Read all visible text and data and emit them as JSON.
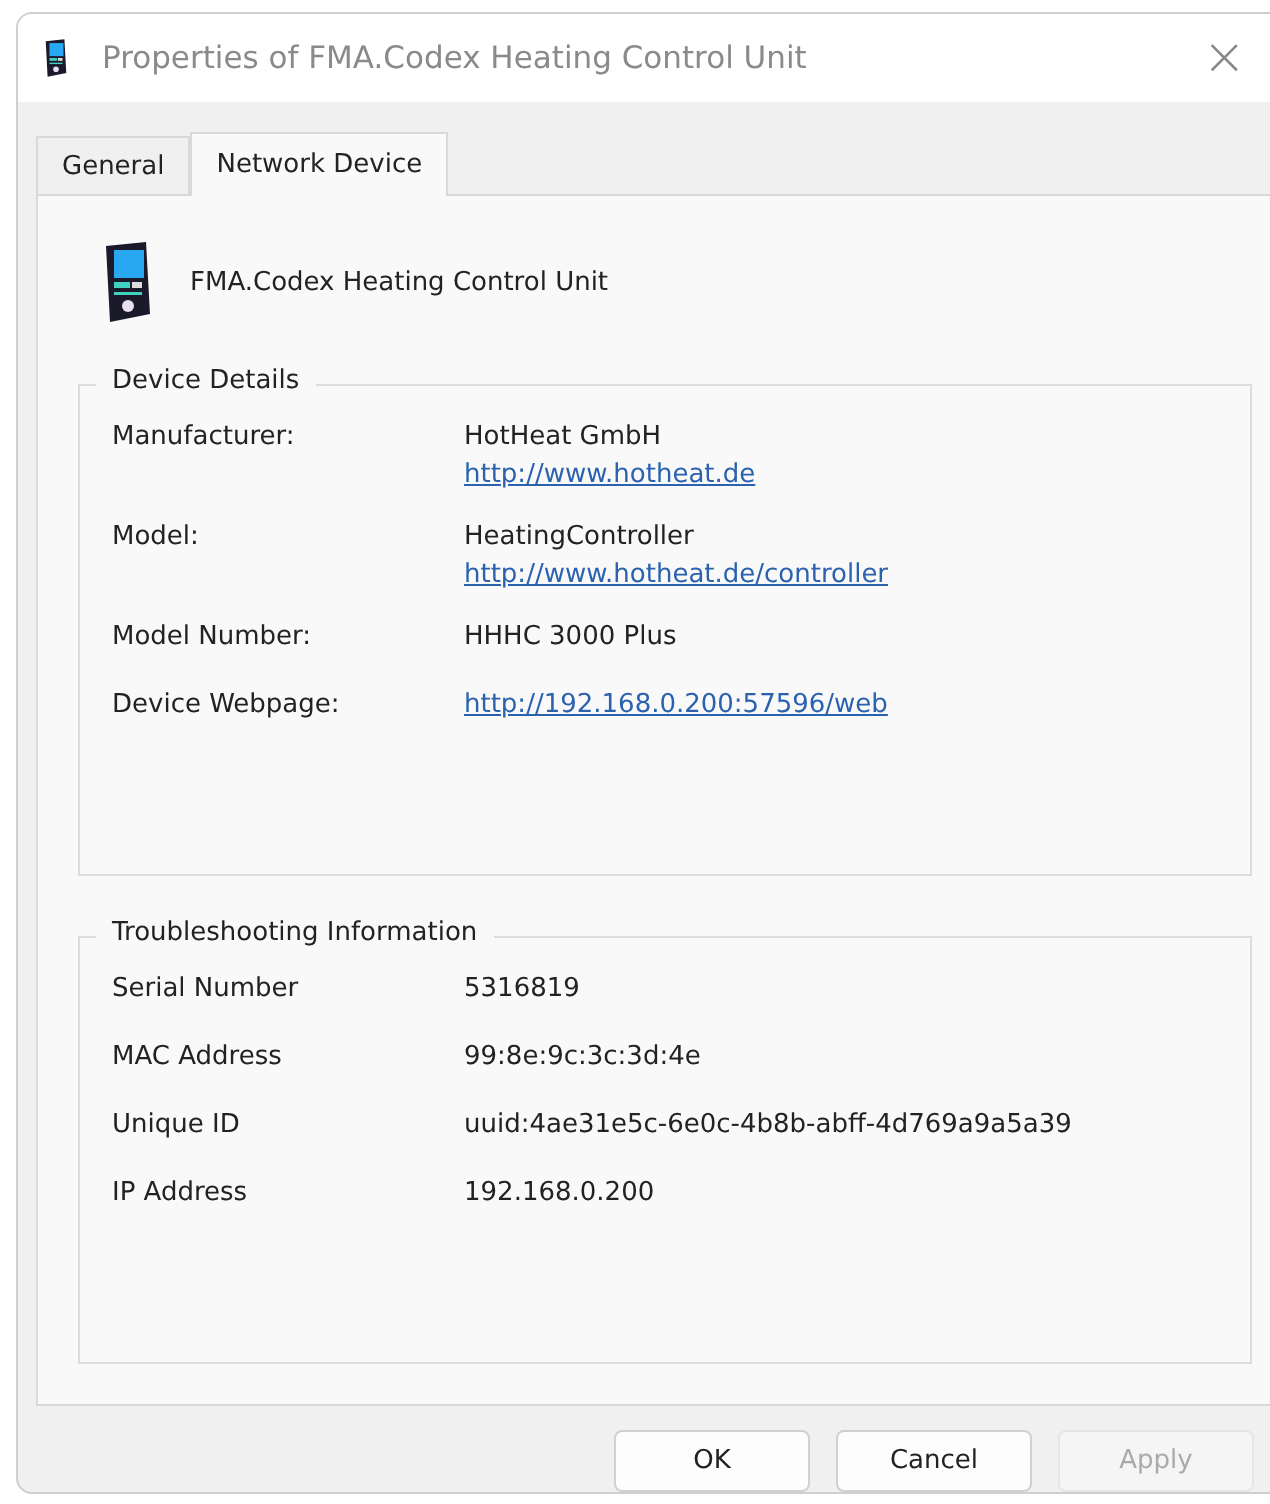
{
  "window": {
    "title": "Properties of FMA.Codex Heating Control Unit",
    "close": "×"
  },
  "tabs": [
    {
      "label": "General",
      "selected": false
    },
    {
      "label": "Network Device",
      "selected": true
    }
  ],
  "device_name": "FMA.Codex Heating Control Unit",
  "groups": [
    {
      "title": "Device Details",
      "rows": [
        {
          "label": "Manufacturer:",
          "value": "HotHeat GmbH",
          "link": "http://www.hotheat.de"
        },
        {
          "label": "Model:",
          "value": "HeatingController",
          "link": "http://www.hotheat.de/controller"
        },
        {
          "label": "Model Number:",
          "value": "HHHC 3000 Plus"
        },
        {
          "label": "Device Webpage:",
          "link": "http://192.168.0.200:57596/web"
        }
      ]
    },
    {
      "title": "Troubleshooting Information",
      "rows": [
        {
          "label": "Serial Number",
          "value": "5316819"
        },
        {
          "label": "MAC Address",
          "value": "99:8e:9c:3c:3d:4e"
        },
        {
          "label": "Unique ID",
          "value": "uuid:4ae31e5c-6e0c-4b8b-abff-4d769a9a5a39"
        },
        {
          "label": "IP Address",
          "value": "192.168.0.200"
        }
      ]
    }
  ],
  "buttons": [
    {
      "label": "OK",
      "disabled": false
    },
    {
      "label": "Cancel",
      "disabled": false
    },
    {
      "label": "Apply",
      "disabled": true
    }
  ]
}
